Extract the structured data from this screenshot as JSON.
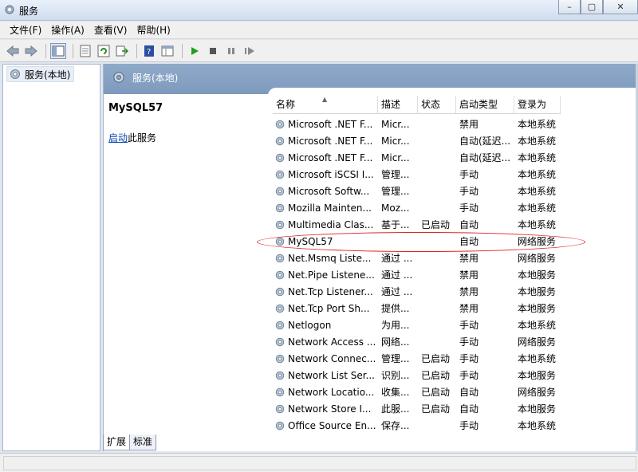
{
  "window": {
    "title": "服务",
    "controls": [
      "–",
      "▢",
      "✕"
    ]
  },
  "menu": [
    {
      "label": "文件(F)"
    },
    {
      "label": "操作(A)"
    },
    {
      "label": "查看(V)"
    },
    {
      "label": "帮助(H)"
    }
  ],
  "tree": {
    "root_label": "服务(本地)"
  },
  "panel": {
    "header_label": "服务(本地)"
  },
  "detail": {
    "service_name": "MySQL57",
    "action_link": "启动",
    "action_suffix": "此服务"
  },
  "columns": [
    "名称",
    "描述",
    "状态",
    "启动类型",
    "登录为"
  ],
  "sort_indicator": "▲",
  "services": [
    {
      "name": "Microsoft .NET F...",
      "desc": "Micr...",
      "status": "",
      "startup": "禁用",
      "logon": "本地系统"
    },
    {
      "name": "Microsoft .NET F...",
      "desc": "Micr...",
      "status": "",
      "startup": "自动(延迟...",
      "logon": "本地系统"
    },
    {
      "name": "Microsoft .NET F...",
      "desc": "Micr...",
      "status": "",
      "startup": "自动(延迟...",
      "logon": "本地系统"
    },
    {
      "name": "Microsoft iSCSI I...",
      "desc": "管理...",
      "status": "",
      "startup": "手动",
      "logon": "本地系统"
    },
    {
      "name": "Microsoft Softw...",
      "desc": "管理...",
      "status": "",
      "startup": "手动",
      "logon": "本地系统"
    },
    {
      "name": "Mozilla Mainten...",
      "desc": "Moz...",
      "status": "",
      "startup": "手动",
      "logon": "本地系统"
    },
    {
      "name": "Multimedia Clas...",
      "desc": "基于...",
      "status": "已启动",
      "startup": "自动",
      "logon": "本地系统"
    },
    {
      "name": "MySQL57",
      "desc": "",
      "status": "",
      "startup": "自动",
      "logon": "网络服务"
    },
    {
      "name": "Net.Msmq Liste...",
      "desc": "通过 ...",
      "status": "",
      "startup": "禁用",
      "logon": "网络服务"
    },
    {
      "name": "Net.Pipe Listene...",
      "desc": "通过 ...",
      "status": "",
      "startup": "禁用",
      "logon": "本地服务"
    },
    {
      "name": "Net.Tcp Listener...",
      "desc": "通过 ...",
      "status": "",
      "startup": "禁用",
      "logon": "本地服务"
    },
    {
      "name": "Net.Tcp Port Sh...",
      "desc": "提供...",
      "status": "",
      "startup": "禁用",
      "logon": "本地服务"
    },
    {
      "name": "Netlogon",
      "desc": "为用...",
      "status": "",
      "startup": "手动",
      "logon": "本地系统"
    },
    {
      "name": "Network Access ...",
      "desc": "网络...",
      "status": "",
      "startup": "手动",
      "logon": "网络服务"
    },
    {
      "name": "Network Connec...",
      "desc": "管理...",
      "status": "已启动",
      "startup": "手动",
      "logon": "本地系统"
    },
    {
      "name": "Network List Ser...",
      "desc": "识别...",
      "status": "已启动",
      "startup": "手动",
      "logon": "本地服务"
    },
    {
      "name": "Network Locatio...",
      "desc": "收集...",
      "status": "已启动",
      "startup": "自动",
      "logon": "网络服务"
    },
    {
      "name": "Network Store I...",
      "desc": "此服...",
      "status": "已启动",
      "startup": "自动",
      "logon": "本地服务"
    },
    {
      "name": "Office Source En...",
      "desc": "保存...",
      "status": "",
      "startup": "手动",
      "logon": "本地系统"
    }
  ],
  "tabs": [
    {
      "label": "扩展"
    },
    {
      "label": "标准"
    }
  ],
  "colors": {
    "header_blue": "#8fa9c9",
    "highlight_red": "#d22",
    "link_blue": "#0645ad"
  }
}
